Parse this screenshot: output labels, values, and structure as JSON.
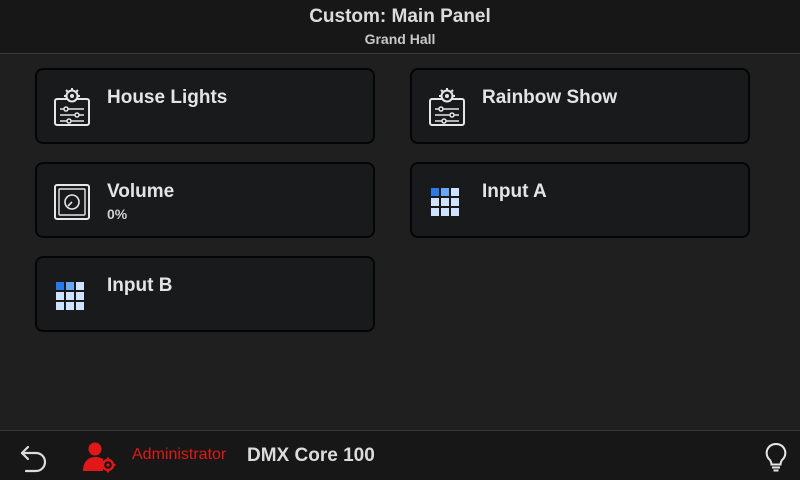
{
  "header": {
    "title": "Custom: Main Panel",
    "subtitle": "Grand Hall"
  },
  "tiles": [
    {
      "label": "House Lights",
      "icon": "preset-settings-icon"
    },
    {
      "label": "Rainbow Show",
      "icon": "preset-settings-icon"
    },
    {
      "label": "Volume",
      "value": "0%",
      "icon": "volume-knob-icon"
    },
    {
      "label": "Input A",
      "icon": "input-grid-icon"
    },
    {
      "label": "Input B",
      "icon": "input-grid-icon"
    }
  ],
  "footer": {
    "user": "Administrator",
    "device": "DMX Core 100",
    "back_icon": "back-icon",
    "user_icon": "admin-user-icon",
    "bulb_icon": "lightbulb-icon"
  },
  "colors": {
    "background": "#1f1f1f",
    "tile_bg": "#181a1c",
    "accent_blue": "#2979e8",
    "grid_light": "#cfe2ff",
    "admin_red": "#e01818"
  }
}
